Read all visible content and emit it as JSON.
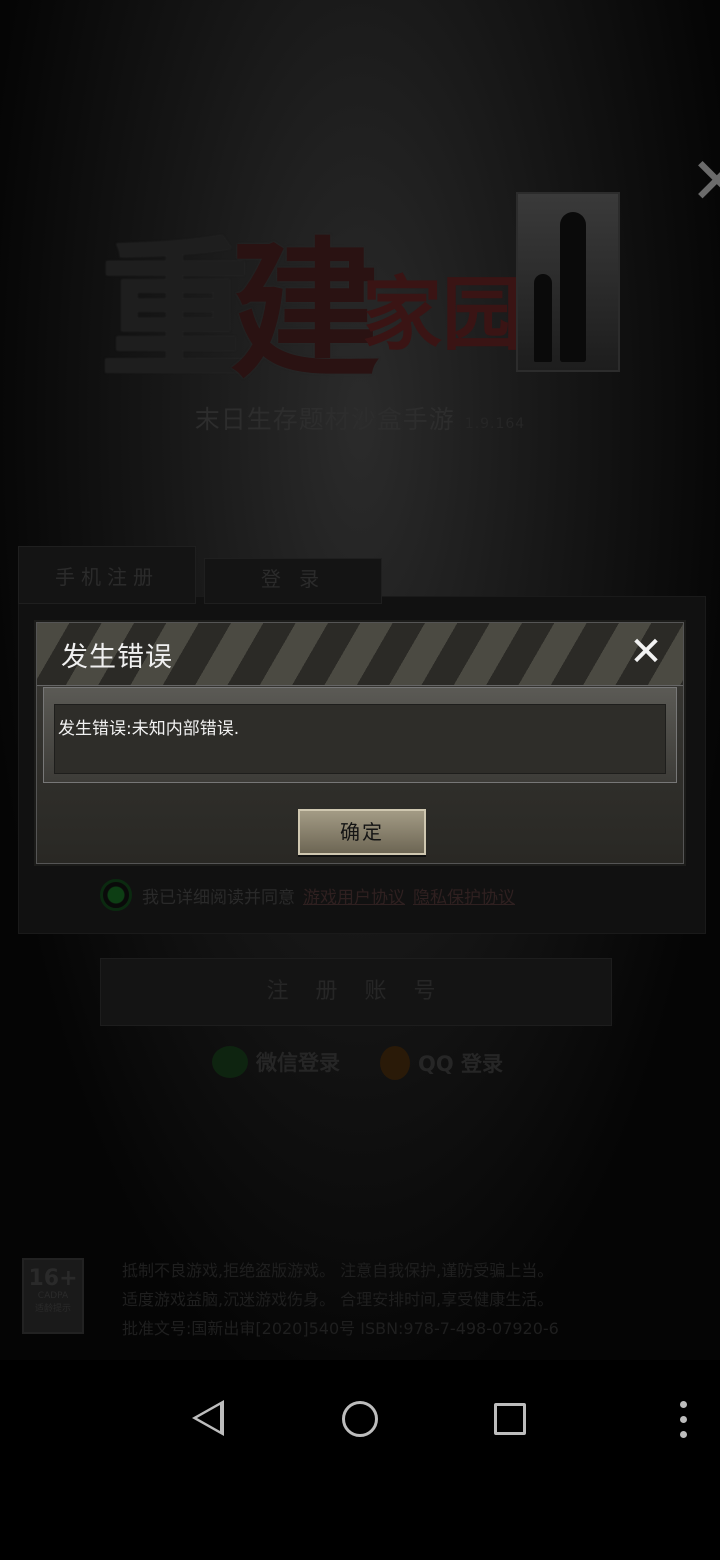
{
  "background": {
    "logo": {
      "big_chars": [
        "重",
        "建"
      ],
      "small_chars": "家园"
    },
    "subtitle": "末日生存题材沙盒手游",
    "version": "1.9.164",
    "tabs": [
      "手机注册",
      "登 录"
    ],
    "agree_text": "我已详细阅读并同意",
    "agree_links": [
      "游戏用户协议",
      "隐私保护协议"
    ],
    "register_button": "注 册 账 号",
    "social": {
      "wechat": "微信登录",
      "qq": "QQ 登录"
    },
    "age_badge": {
      "number": "16+",
      "brand": "CADPA",
      "label": "适龄提示"
    },
    "notice_lines": [
      "抵制不良游戏,拒绝盗版游戏。 注意自我保护,谨防受骗上当。",
      "适度游戏益脑,沉迷游戏伤身。 合理安排时间,享受健康生活。",
      "批准文号:国新出审[2020]540号    ISBN:978-7-498-07920-6"
    ]
  },
  "dialog": {
    "title": "发生错误",
    "message": "发生错误:未知内部错误.",
    "ok_label": "确定"
  },
  "icons": {
    "close": "close-icon",
    "back": "back-icon",
    "home": "home-icon",
    "recent": "recent-apps-icon",
    "more": "more-vert-icon"
  },
  "colors": {
    "dialog_text": "#f0f0f0",
    "accent_green": "#0d3e14"
  }
}
